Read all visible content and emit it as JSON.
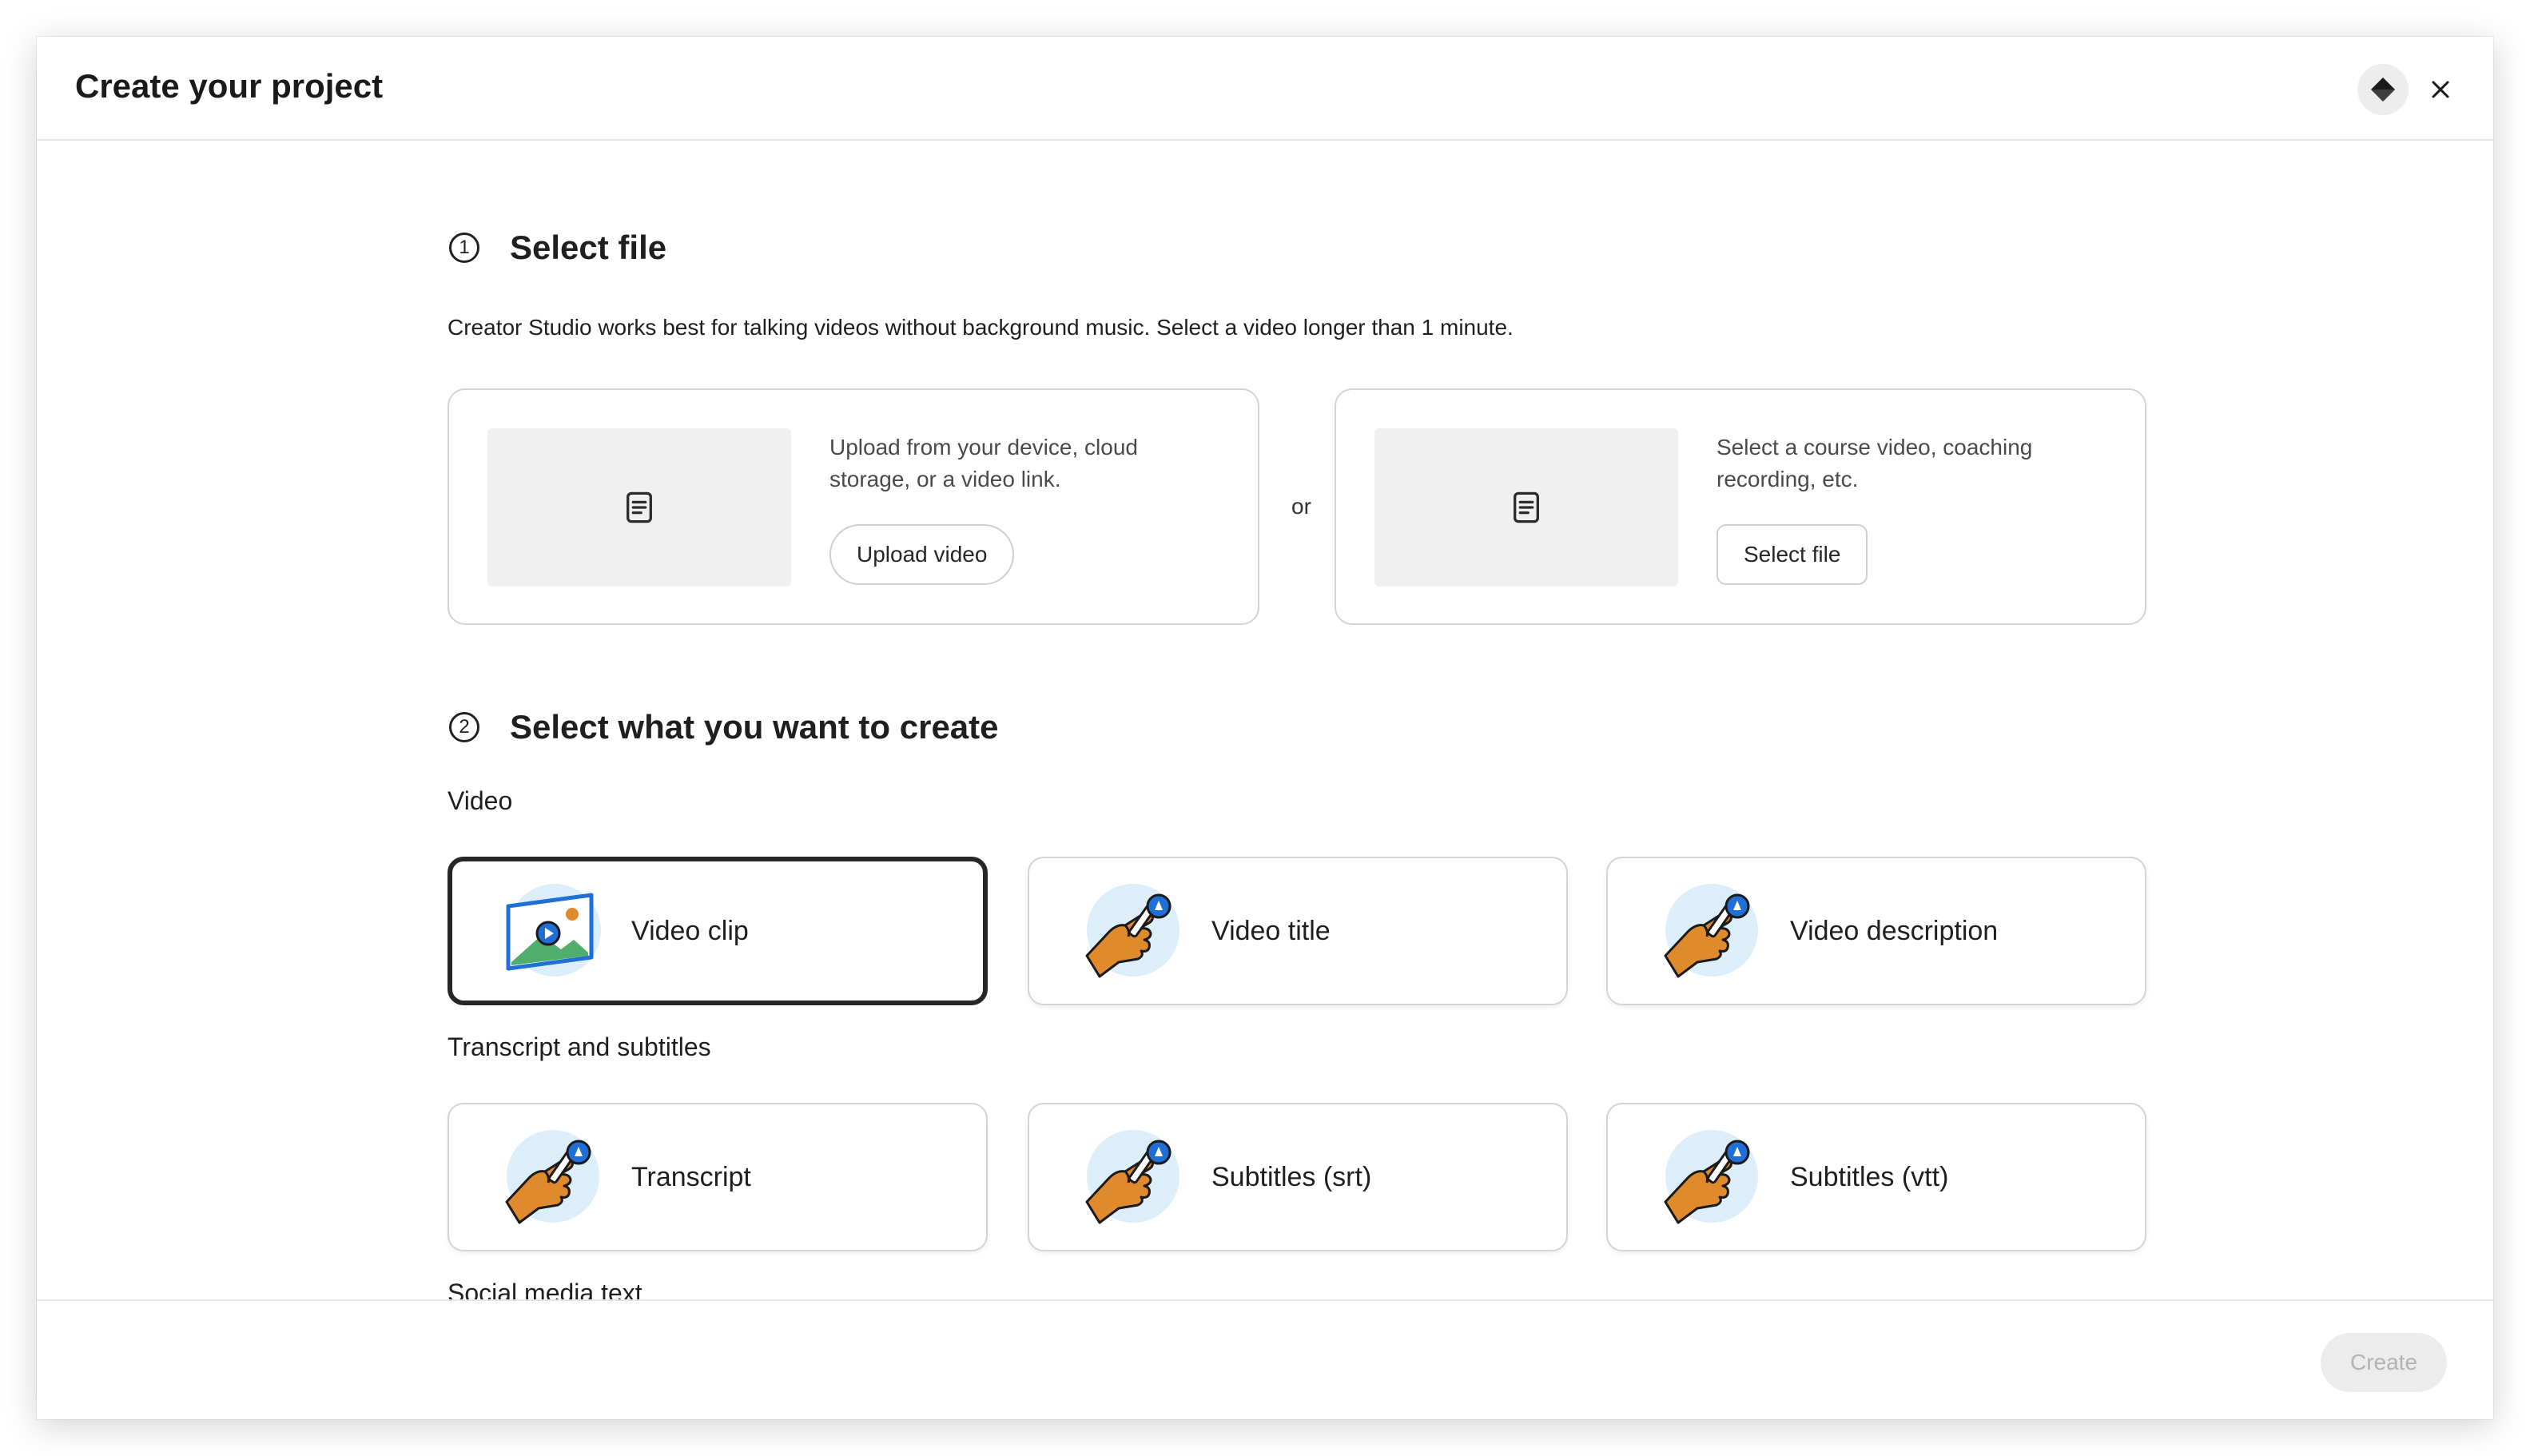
{
  "header": {
    "title": "Create your project",
    "premium_icon": "diamond-icon",
    "close_icon": "close-icon"
  },
  "step1": {
    "number": "1",
    "title": "Select file",
    "hint": "Creator Studio works best for talking videos without background music. Select a video longer than 1 minute.",
    "upload_card": {
      "icon": "document-icon",
      "description": "Upload from your device, cloud storage, or a video link.",
      "button_label": "Upload video"
    },
    "separator": "or",
    "select_card": {
      "icon": "document-icon",
      "description": "Select a course video, coaching recording, etc.",
      "button_label": "Select file"
    }
  },
  "step2": {
    "number": "2",
    "title": "Select what you want to create",
    "groups": [
      {
        "label": "Video",
        "options": [
          {
            "label": "Video clip",
            "icon": "video-image-icon",
            "selected": true
          },
          {
            "label": "Video title",
            "icon": "hand-pen-icon",
            "selected": false
          },
          {
            "label": "Video description",
            "icon": "hand-pen-icon",
            "selected": false
          }
        ]
      },
      {
        "label": "Transcript and subtitles",
        "options": [
          {
            "label": "Transcript",
            "icon": "hand-pen-icon",
            "selected": false
          },
          {
            "label": "Subtitles (srt)",
            "icon": "hand-pen-icon",
            "selected": false
          },
          {
            "label": "Subtitles (vtt)",
            "icon": "hand-pen-icon",
            "selected": false
          }
        ]
      },
      {
        "label": "Social media text",
        "options": []
      }
    ]
  },
  "footer": {
    "create_label": "Create",
    "create_enabled": false
  },
  "colors": {
    "accent_blue": "#1f6fd6",
    "hand_orange": "#e08a2e",
    "icon_bg": "#dbeefa",
    "disabled_bg": "#ececec",
    "disabled_text": "#b3b3b3"
  }
}
